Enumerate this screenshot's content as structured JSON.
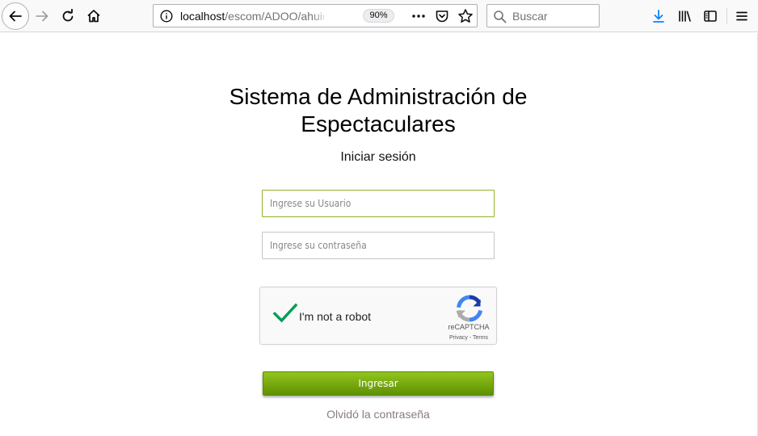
{
  "browser": {
    "url_host": "localhost",
    "url_path": "/escom/ADOO/ahuic/l",
    "zoom": "90%",
    "search_placeholder": "Buscar"
  },
  "login": {
    "title_line1": "Sistema de Administración de",
    "title_line2": "Espectaculares",
    "subtitle": "Iniciar sesión",
    "user_placeholder": "Ingrese su Usuario",
    "password_placeholder": "Ingrese su contraseña",
    "submit_label": "Ingresar",
    "forgot_label": "Olvidó la contraseña"
  },
  "recaptcha": {
    "label": "I'm not a robot",
    "brand": "reCAPTCHA",
    "privacy": "Privacy",
    "separator": " - ",
    "terms": "Terms",
    "checked": true
  },
  "colors": {
    "accent_green": "#7ab010",
    "focus_border": "#93b32b",
    "check_green": "#009e55",
    "link_muted": "#8a7b80",
    "download_blue": "#0a84ff"
  }
}
